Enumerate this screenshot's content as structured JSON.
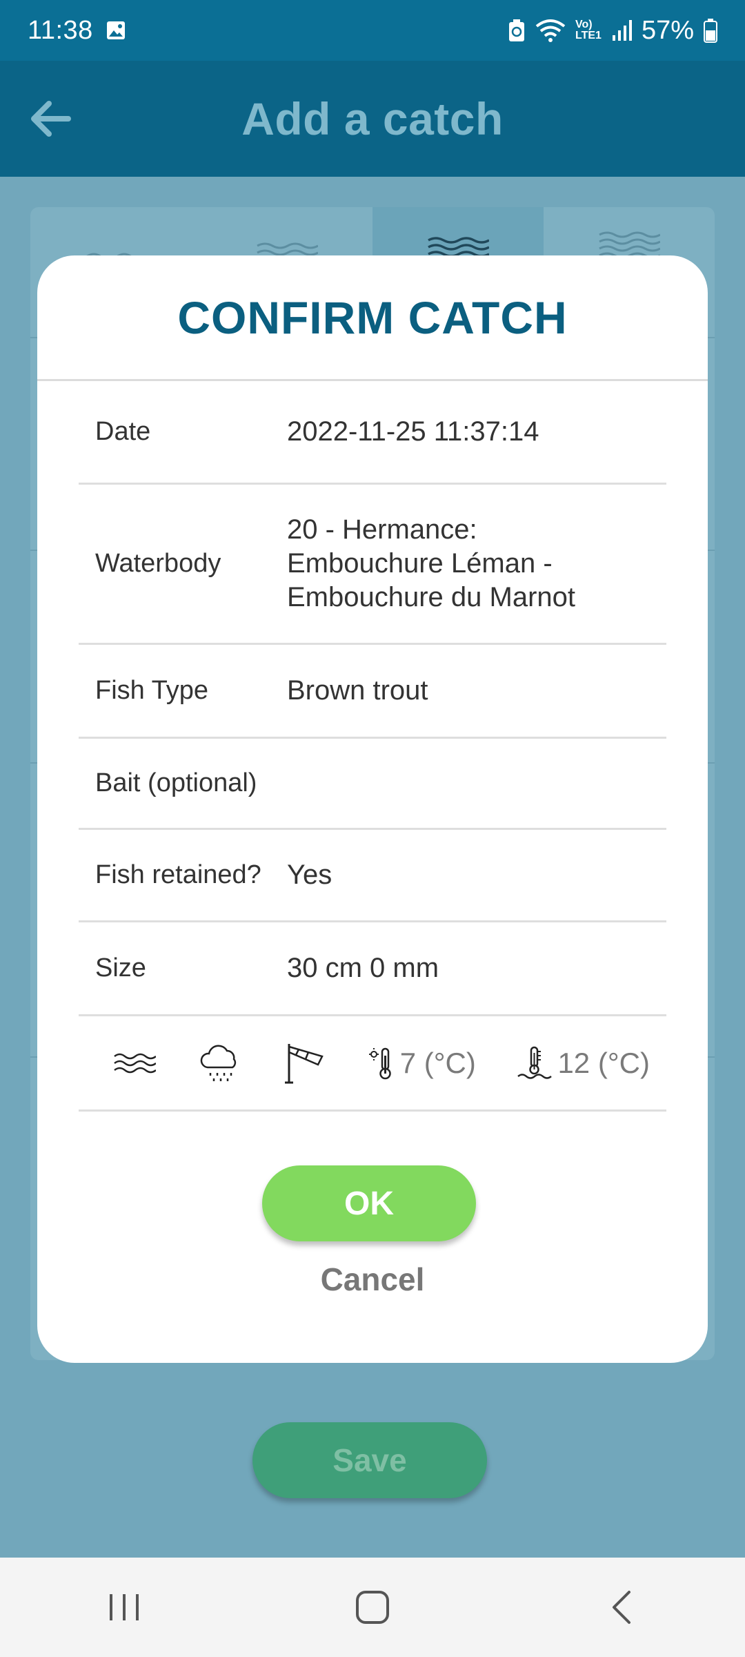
{
  "status_bar": {
    "time": "11:38",
    "battery": "57%",
    "icons": [
      "gallery-icon",
      "battery-saver-icon",
      "wifi-icon",
      "volte-icon",
      "signal-icon",
      "battery-icon"
    ],
    "volte_label_top": "Vo)",
    "volte_label_bottom": "LTE1"
  },
  "app_bar": {
    "title": "Add a catch",
    "back_icon": "arrow-left-icon"
  },
  "background": {
    "save_label": "Save"
  },
  "dialog": {
    "title": "CONFIRM CATCH",
    "rows": {
      "date": {
        "label": "Date",
        "value": "2022-11-25 11:37:14"
      },
      "waterbody": {
        "label": "Waterbody",
        "value": "20 - Hermance: Embouchure Léman - Embouchure du Marnot"
      },
      "fish_type": {
        "label": "Fish Type",
        "value": "Brown trout"
      },
      "bait": {
        "label": "Bait (optional)",
        "value": ""
      },
      "retained": {
        "label": "Fish retained?",
        "value": "Yes"
      },
      "size": {
        "label": "Size",
        "value": "30 cm 0 mm"
      }
    },
    "conditions": {
      "water_icon": "water-waves-icon",
      "weather_icon": "rain-cloud-icon",
      "wind_icon": "windsock-icon",
      "air_temp": "7 (°C)",
      "water_temp": "12 (°C)"
    },
    "ok_label": "OK",
    "cancel_label": "Cancel"
  },
  "nav_bar": {
    "icons": [
      "recent-apps-icon",
      "home-icon",
      "back-icon"
    ]
  },
  "colors": {
    "primary": "#0b6487",
    "title": "#0b5f80",
    "ok": "#82d95e",
    "save": "#3f9f79"
  }
}
